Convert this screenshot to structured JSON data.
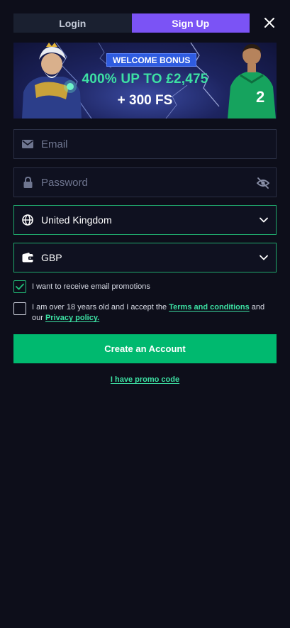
{
  "tabs": {
    "login_label": "Login",
    "signup_label": "Sign Up",
    "active": "signup"
  },
  "banner": {
    "badge": "WELCOME BONUS",
    "amount": "400% UP TO £2,475",
    "free_spins": "+ 300 FS"
  },
  "form": {
    "email_placeholder": "Email",
    "password_placeholder": "Password",
    "country_value": "United Kingdom",
    "currency_value": "GBP",
    "email_promotions_label": "I want to receive email promotions",
    "email_promotions_checked": true,
    "terms_text_before": "I am over 18 years old and I accept the ",
    "terms_link": "Terms and conditions",
    "terms_text_middle": " and our ",
    "privacy_link": "Privacy policy.",
    "terms_checked": false,
    "submit_label": "Create an Account",
    "promo_code_link": "I have promo code"
  },
  "icons": {
    "close": "close-icon",
    "email": "envelope-icon",
    "password": "lock-icon",
    "toggle_visibility": "eye-off-icon",
    "country": "globe-icon",
    "currency": "wallet-icon",
    "dropdown": "chevron-down-icon",
    "check": "checkmark-icon"
  },
  "colors": {
    "background": "#0d0e1a",
    "tab_active": "#7b53f5",
    "tab_inactive": "#1a2030",
    "accent_green": "#00b96f",
    "link_green": "#3de0a3",
    "select_border": "#20a86c",
    "badge_blue": "#2f5ce0"
  }
}
